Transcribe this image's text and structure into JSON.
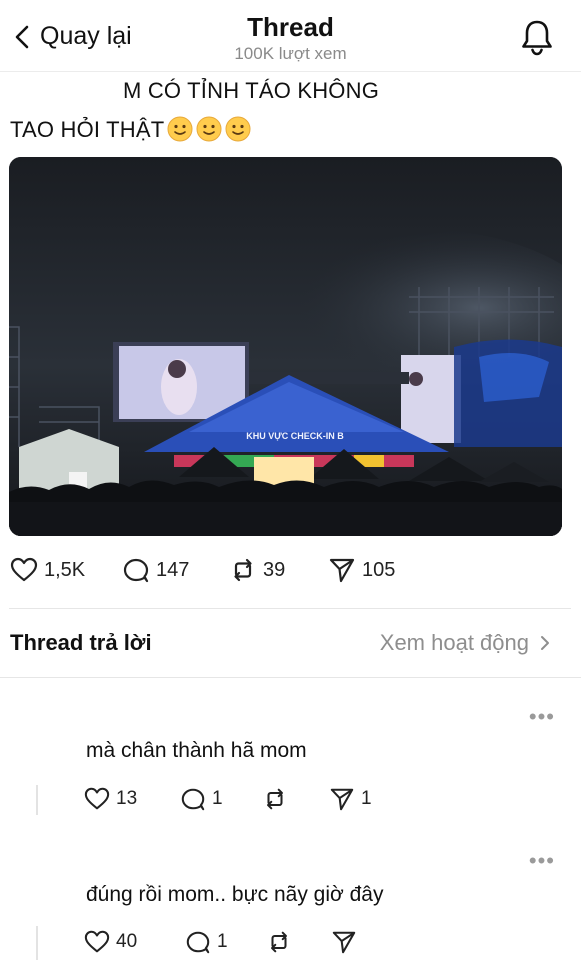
{
  "header": {
    "back_label": "Quay lại",
    "title": "Thread",
    "subtitle": "100K lượt xem"
  },
  "post": {
    "line1": "M CÓ TỈNH TÁO KHÔNG",
    "line2": "TAO HỎI THẬT",
    "emoji_count": 3,
    "image": {
      "banner_text": "KHU VỰC CHECK-IN B"
    },
    "stats": {
      "likes": "1,5K",
      "replies": "147",
      "reposts": "39",
      "shares": "105"
    }
  },
  "replies_section": {
    "title": "Thread trả lời",
    "activity_label": "Xem hoạt động"
  },
  "replies": [
    {
      "text": "mà chân thành hã mom",
      "likes": "13",
      "replies": "1",
      "reposts": "",
      "shares": "1"
    },
    {
      "text": "đúng rồi mom.. bực nãy giờ đây",
      "likes": "40",
      "replies": "1",
      "reposts": "",
      "shares": ""
    }
  ],
  "colors": {
    "text": "#111111",
    "muted": "#8a8a8a",
    "divider": "#e6e6e6",
    "tent_blue": "#2a4fb8"
  },
  "icons": [
    "back-chevron-icon",
    "bell-icon",
    "heart-icon",
    "comment-icon",
    "repost-icon",
    "send-icon",
    "chevron-right-icon",
    "more-icon",
    "smile-emoji-icon"
  ]
}
